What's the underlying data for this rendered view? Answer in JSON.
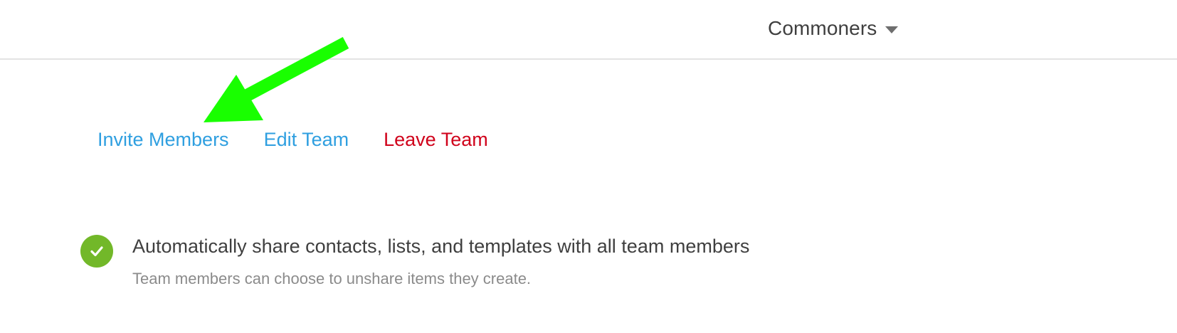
{
  "header": {
    "team_name": "Commoners",
    "dropdown_icon": "chevron-down-icon"
  },
  "team_actions": {
    "invite_label": "Invite Members",
    "edit_label": "Edit Team",
    "leave_label": "Leave Team",
    "link_color": "#2f9fe0",
    "danger_color": "#d0021b"
  },
  "settings": {
    "auto_share": {
      "enabled": true,
      "icon": "check-circle-icon",
      "title": "Automatically share contacts, lists, and templates with all team members",
      "description": "Team members can choose to unshare items they create.",
      "icon_color": "#72b829"
    }
  },
  "annotation": {
    "icon": "arrow-annotation-icon",
    "color": "#19ff00"
  }
}
